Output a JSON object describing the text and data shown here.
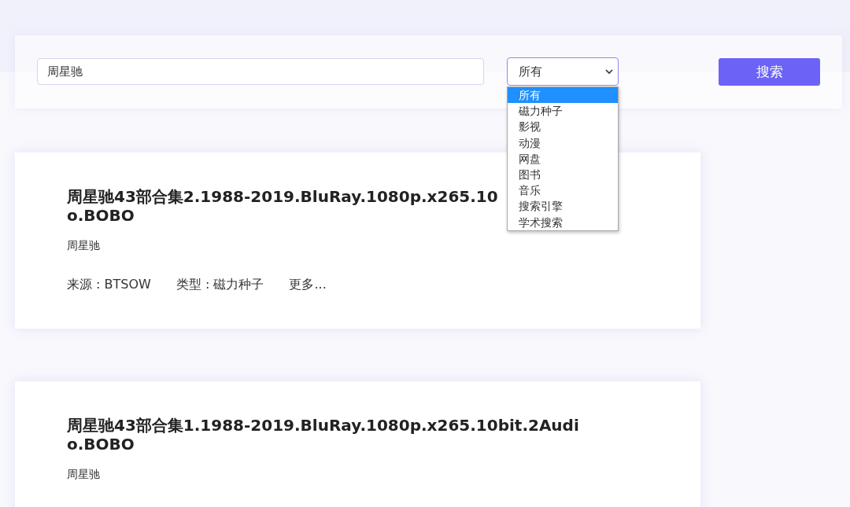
{
  "search": {
    "query": "周星驰",
    "category": "所有",
    "button": "搜索"
  },
  "category_menu": [
    {
      "label": "所有",
      "selected": true
    },
    {
      "label": "磁力种子",
      "selected": false
    },
    {
      "label": "影视",
      "selected": false
    },
    {
      "label": "动漫",
      "selected": false
    },
    {
      "label": "网盘",
      "selected": false
    },
    {
      "label": "图书",
      "selected": false
    },
    {
      "label": "音乐",
      "selected": false
    },
    {
      "label": "搜索引擎",
      "selected": false
    },
    {
      "label": "学术搜索",
      "selected": false
    }
  ],
  "results": [
    {
      "title_lines": [
        "周星驰43部合集2.1988-2019.BluRay.1080p.x265.10",
        "o.BOBO"
      ],
      "keyword": "周星驰",
      "meta": [
        "来源 : BTSOW",
        "类型 : 磁力种子"
      ],
      "more": "更多..."
    },
    {
      "title_lines": [
        "周星驰43部合集1.1988-2019.BluRay.1080p.x265.10bit.2Audi",
        "o.BOBO"
      ],
      "keyword": "周星驰"
    }
  ]
}
